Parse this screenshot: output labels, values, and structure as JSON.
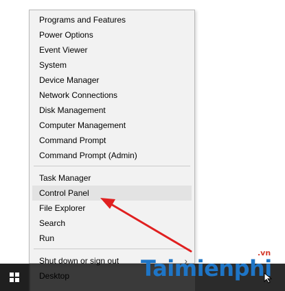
{
  "menu": {
    "group1": [
      {
        "label": "Programs and Features"
      },
      {
        "label": "Power Options"
      },
      {
        "label": "Event Viewer"
      },
      {
        "label": "System"
      },
      {
        "label": "Device Manager"
      },
      {
        "label": "Network Connections"
      },
      {
        "label": "Disk Management"
      },
      {
        "label": "Computer Management"
      },
      {
        "label": "Command Prompt"
      },
      {
        "label": "Command Prompt (Admin)"
      }
    ],
    "group2": [
      {
        "label": "Task Manager"
      },
      {
        "label": "Control Panel",
        "highlighted": true
      },
      {
        "label": "File Explorer"
      },
      {
        "label": "Search"
      },
      {
        "label": "Run"
      }
    ],
    "group3": [
      {
        "label": "Shut down or sign out",
        "has_submenu": true
      },
      {
        "label": "Desktop"
      }
    ]
  },
  "watermark": {
    "text": "Taimienphi",
    "sub": ".vn"
  },
  "colors": {
    "menu_bg": "#f2f2f2",
    "highlight_bg": "#e3e3e3",
    "arrow": "#e02020",
    "watermark": "#1e75c6",
    "taskbar": "#2b2b2b"
  },
  "icons": {
    "start": "windows-logo-icon",
    "submenu": "chevron-right-icon",
    "pointer": "mouse-cursor-icon"
  }
}
